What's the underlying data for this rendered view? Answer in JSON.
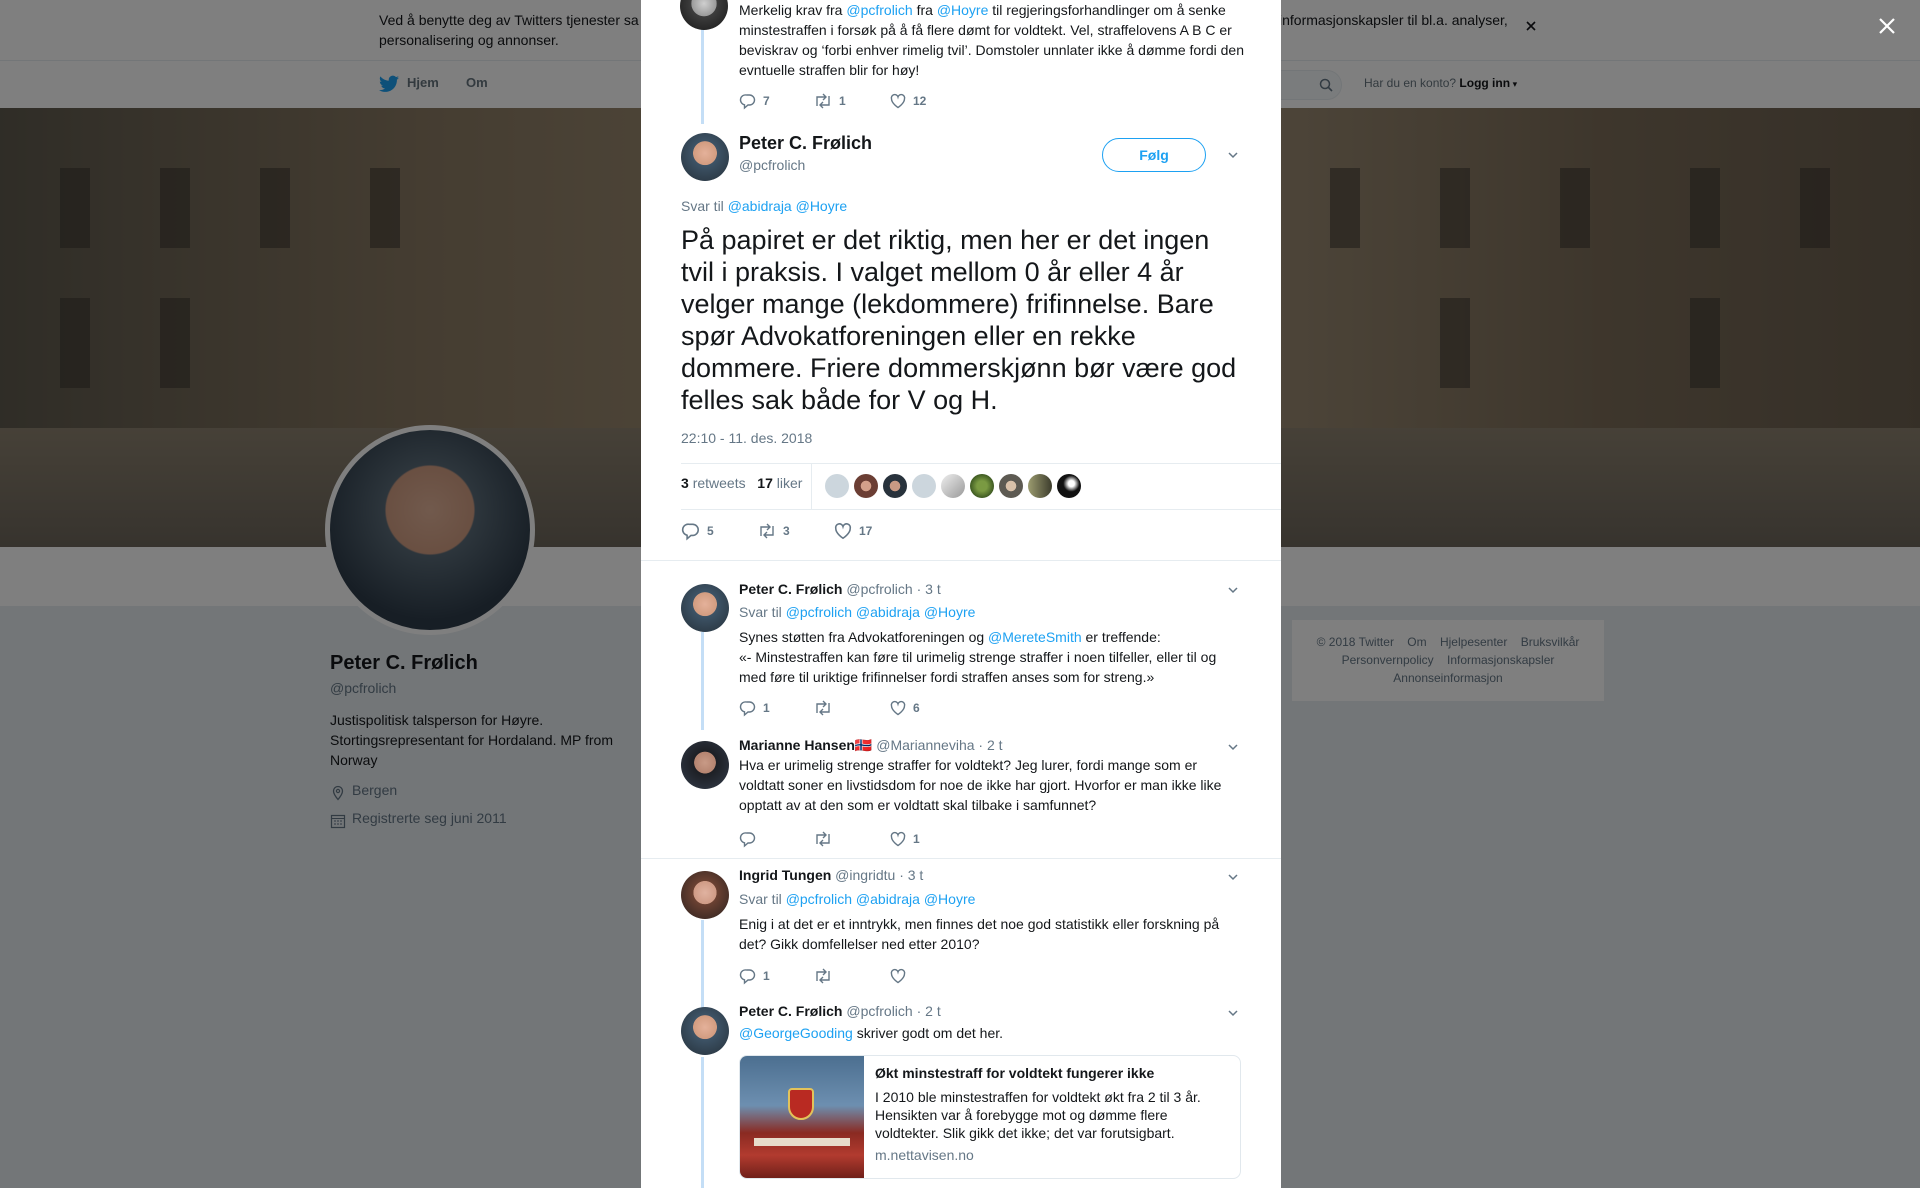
{
  "cookie_banner": {
    "text": "Ved å benytte deg av Twitters tjenester sa... informasjonskapsler til bl.a. analyser, personalisering og annonser.",
    "text_left": "Ved å benytte deg av Twitters tjenester sa",
    "text_right": "informasjonskapsler til bl.a. analyser,",
    "text_line2": "personalisering og annonser."
  },
  "nav": {
    "home": "Hjem",
    "about": "Om",
    "have_account": "Har du en konto?",
    "login": "Logg inn"
  },
  "profile": {
    "name": "Peter C. Frølich",
    "handle": "@pcfrolich",
    "bio": "Justispolitisk talsperson for Høyre. Stortingsrepresentant for Hordaland. MP from Norway",
    "location": "Bergen",
    "joined": "Registrerte seg juni 2011"
  },
  "footer": {
    "links": [
      "© 2018 Twitter",
      "Om",
      "Hjelpesenter",
      "Bruksvilkår",
      "Personvernpolicy",
      "Informasjonskapsler",
      "Annonseinformasjon"
    ]
  },
  "top_tweet": {
    "line1_pre": "Merkelig krav fra ",
    "mention1": "@pcfrolich",
    "line1_mid": " fra ",
    "mention2": "@Hoyre",
    "line1_post": " til regjeringsforhandlinger om å senke",
    "rest": "minstestraffen i forsøk på å få flere dømt for voldtekt. Vel, straffelovens A B C er beviskrav og ‘forbi enhver rimelig tvil’. Domstoler unnlater ikke å dømme fordi den evntuelle straffen blir for høy!",
    "replies": "7",
    "retweets": "1",
    "likes": "12"
  },
  "main_tweet": {
    "name": "Peter C. Frølich",
    "handle": "@pcfrolich",
    "follow": "Følg",
    "reply_to_label": "Svar til",
    "reply_to": "@abidraja @Hoyre",
    "text": "På papiret er det riktig, men her er det ingen tvil i praksis. I valget mellom 0 år eller 4 år velger mange (lekdommere) frifinnelse. Bare spør Advokatforeningen eller en rekke dommere. Friere dommerskjønn bør være god felles sak både for V og H.",
    "timestamp": "22:10 - 11. des. 2018",
    "retweets_count": "3",
    "retweets_label": "retweets",
    "likes_count": "17",
    "likes_label": "liker",
    "replies": "5",
    "retweets": "3",
    "likes": "17"
  },
  "replies": [
    {
      "name": "Peter C. Frølich",
      "handle": "@pcfrolich",
      "time": "· 3 t",
      "reply_to_label": "Svar til",
      "reply_to": "@pcfrolich @abidraja @Hoyre",
      "text_pre": "Synes støtten fra Advokatforeningen og ",
      "mention": "@MereteSmith",
      "text_post": " er treffende:",
      "text_rest": "«- Minstestraffen kan føre til urimelig strenge straffer i noen tilfeller, eller til og med føre til uriktige frifinnelser fordi straffen anses som for streng.»",
      "replies": "1",
      "retweets": "",
      "likes": "6"
    },
    {
      "name": "Marianne Hansen🇳🇴",
      "handle": "@Marianneviha",
      "time": "· 2 t",
      "text": "Hva er urimelig strenge straffer for voldtekt? Jeg lurer, fordi mange som er voldtatt soner en livstidsdom for noe de ikke har gjort. Hvorfor er man ikke like opptatt av at den som er voldtatt skal tilbake i samfunnet?",
      "replies": "",
      "retweets": "",
      "likes": "1"
    },
    {
      "name": "Ingrid Tungen",
      "handle": "@ingridtu",
      "time": "· 3 t",
      "reply_to_label": "Svar til",
      "reply_to": "@pcfrolich @abidraja @Hoyre",
      "text": "Enig i at det er et inntrykk, men finnes det noe god statistikk eller forskning på det? Gikk domfellelser ned etter 2010?",
      "replies": "1",
      "retweets": "",
      "likes": ""
    },
    {
      "name": "Peter C. Frølich",
      "handle": "@pcfrolich",
      "time": "· 2 t",
      "mention": "@GeorgeGooding",
      "text_post": " skriver godt om det her.",
      "card": {
        "title": "Økt minstestraff for voldtekt fungerer ikke",
        "description": "I 2010 ble minstestraffen for voldtekt økt fra 2 til 3 år. Hensikten var å forebygge mot og dømme flere voldtekter. Slik gikk det ikke; det var forutsigbart.",
        "domain": "m.nettavisen.no"
      }
    }
  ],
  "colors": {
    "accent": "#1da1f2",
    "muted": "#657786",
    "thread": "#c4def6"
  }
}
